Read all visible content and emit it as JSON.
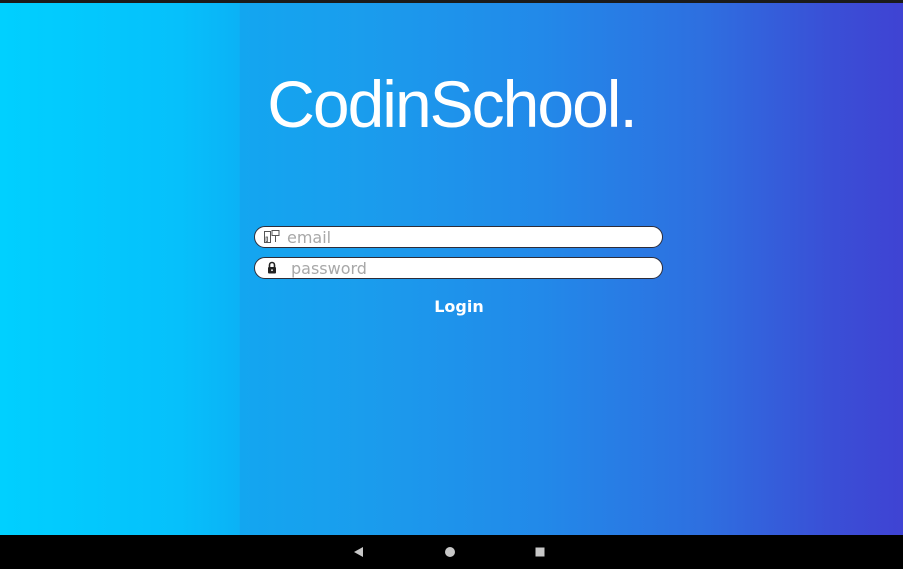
{
  "app": {
    "logo_text": "CodinSchool."
  },
  "login_form": {
    "email": {
      "placeholder": "email",
      "value": "",
      "icon": "id-card-icon"
    },
    "password": {
      "placeholder": "password",
      "value": "",
      "icon": "lock-icon"
    },
    "login_label": "Login"
  },
  "navigation_bar": {
    "buttons": [
      "back-icon",
      "home-icon",
      "recents-icon"
    ]
  },
  "colors": {
    "gradient_start": "#00d0ff",
    "gradient_end": "#3f43d3",
    "text": "#ffffff",
    "field_bg": "#ffffff",
    "placeholder": "#a8a8a8",
    "nav_bar": "#000000"
  }
}
